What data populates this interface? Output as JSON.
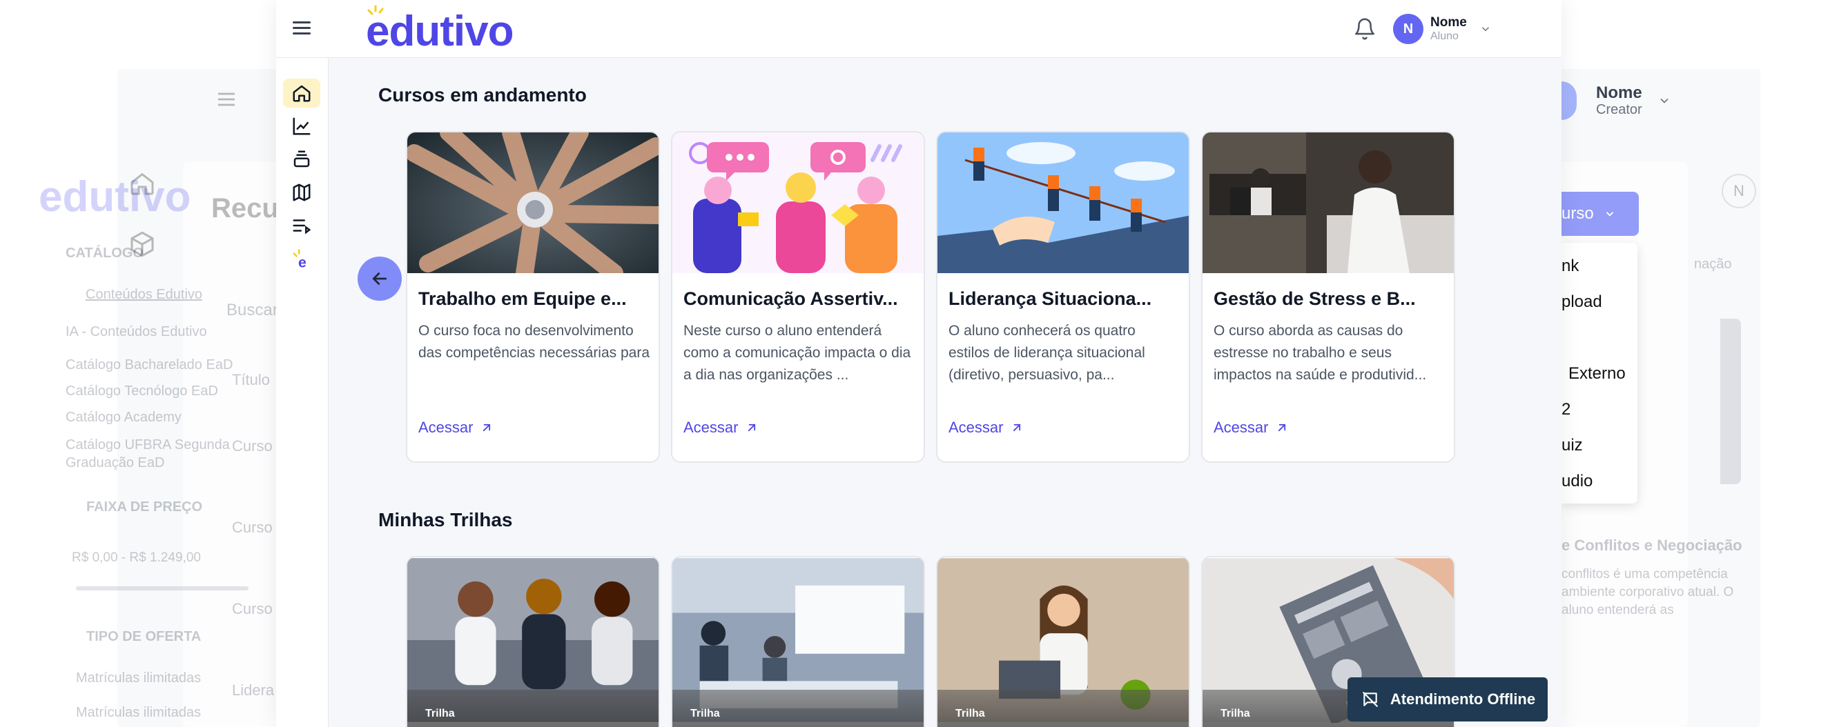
{
  "brand": {
    "logo_text": "edutivo",
    "logo_color": "#4f46e5",
    "accent": "#818cf8"
  },
  "header": {
    "user_name": "Nome",
    "user_role": "Aluno",
    "avatar_letter": "N"
  },
  "sidebar": {
    "items": [
      {
        "icon": "home-icon",
        "active": true
      },
      {
        "icon": "chart-line-icon",
        "active": false
      },
      {
        "icon": "stack-icon",
        "active": false
      },
      {
        "icon": "map-icon",
        "active": false
      },
      {
        "icon": "playlist-icon",
        "active": false
      },
      {
        "icon": "edutivo-logo-icon",
        "active": false
      }
    ]
  },
  "sections": {
    "courses_title": "Cursos em andamento",
    "tracks_title": "Minhas Trilhas"
  },
  "courses": [
    {
      "title": "Trabalho em Equipe e...",
      "description": "O curso foca no desenvolvimento das competências necessárias para",
      "link": "Acessar"
    },
    {
      "title": "Comunicação Assertiv...",
      "description": "Neste curso o aluno entenderá como a comunicação impacta o dia a dia nas organizações ...",
      "link": "Acessar"
    },
    {
      "title": "Liderança Situaciona...",
      "description": "O aluno conhecerá os quatro estilos de liderança situacional (diretivo, persuasivo, pa...",
      "link": "Acessar"
    },
    {
      "title": "Gestão de Stress e B...",
      "description": "O curso aborda as causas do estresse no trabalho e seus impactos na saúde e produtivid...",
      "link": "Acessar"
    }
  ],
  "tracks": [
    {
      "badge": "Trilha"
    },
    {
      "badge": "Trilha"
    },
    {
      "badge": "Trilha"
    },
    {
      "badge": "Trilha"
    }
  ],
  "offline_chat": {
    "label": "Atendimento Offline"
  },
  "background_creator": {
    "user_name": "Nome",
    "user_role": "Creator",
    "page_title": "Recu",
    "search_placeholder": "Buscar",
    "catalog_heading": "CATÁLOGO",
    "catalog_items": [
      "Conteúdos Edutivo",
      "IA - Conteúdos Edutivo",
      "Catálogo Bacharelado EaD",
      "Catálogo Tecnólogo EaD",
      "Catálogo Academy",
      "Catálogo UFBRA Segunda Graduação EaD"
    ],
    "price_heading": "FAIXA DE PREÇO",
    "price_range": "R$ 0,00 - R$ 1.249,00",
    "offer_heading": "TIPO DE OFERTA",
    "offer_items": [
      "Matrículas ilimitadas",
      "Matrículas ilimitadas"
    ],
    "table_header": "Título",
    "table_rows": [
      "Curso",
      "Curso",
      "Curso",
      "Lidera"
    ],
    "add_button": "urso",
    "dropdown_items": [
      "nk",
      "pload",
      "Externo",
      "2",
      "uiz",
      "udio"
    ],
    "sort_label": "nação",
    "right_card_title": "e Conflitos e Negociação",
    "right_card_desc": "conflitos é uma competência ambiente corporativo atual. O aluno entenderá as",
    "avatar_letter": "N"
  }
}
